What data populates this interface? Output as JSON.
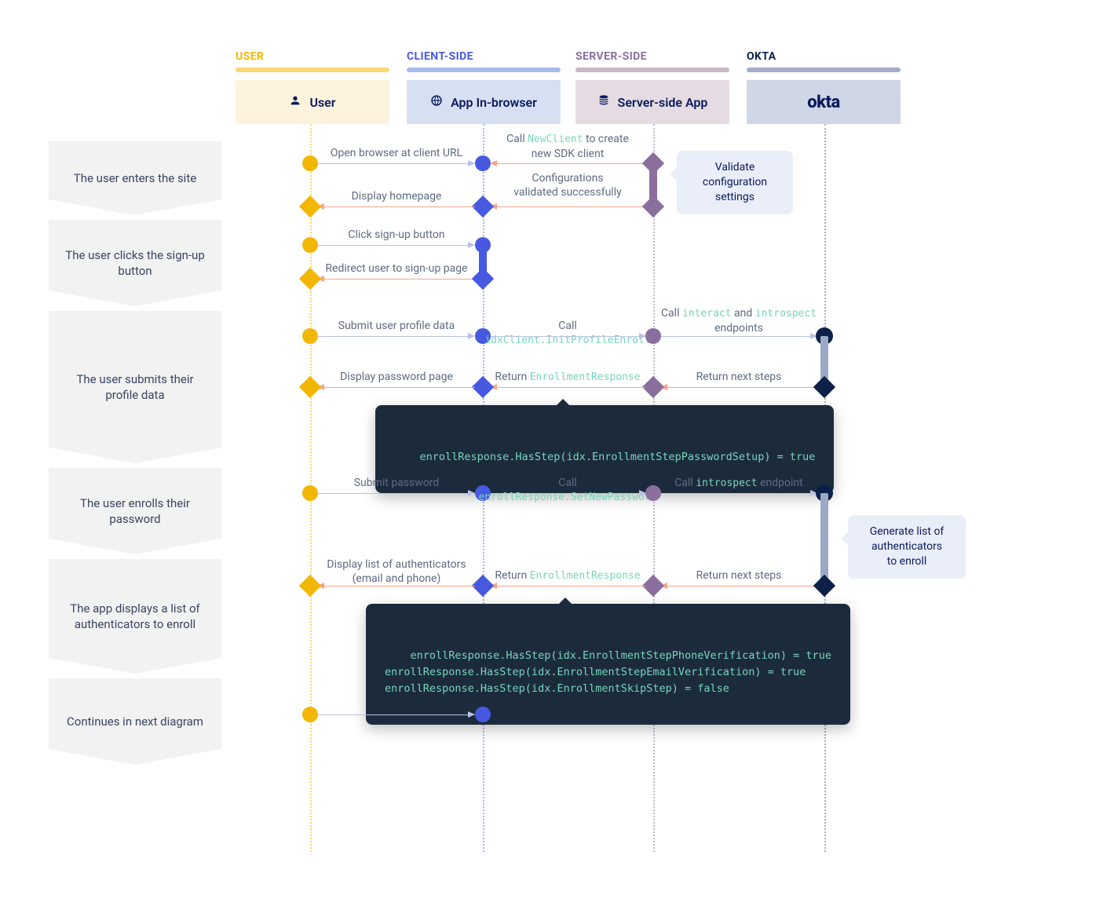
{
  "columns": {
    "user": {
      "label": "USER",
      "lane_label": "User",
      "color": "#f2b705",
      "bg": "#fdf3dd"
    },
    "client": {
      "label": "CLIENT-SIDE",
      "lane_label": "App In-browser",
      "color": "#4659e0",
      "bg": "#d6e0f2"
    },
    "server": {
      "label": "SERVER-SIDE",
      "lane_label": "Server-side App",
      "color": "#8a6f9e",
      "bg": "#e6dbe2"
    },
    "okta": {
      "label": "OKTA",
      "lane_label": "okta",
      "color": "#0c2048",
      "bg": "#cfd6e5"
    }
  },
  "step_arrows": [
    "The user enters the site",
    "The user clicks the sign-up button",
    "The user submits their profile data",
    "The user enrolls their password",
    "The app displays a list of authenticators to enroll",
    "Continues in next diagram"
  ],
  "callouts": {
    "validate": {
      "lines": [
        "Validate",
        "configuration",
        "settings"
      ]
    },
    "generate_auth": {
      "lines": [
        "Generate list of",
        "authenticators",
        "to enroll"
      ]
    }
  },
  "messages": {
    "open_browser": "Open browser at client URL",
    "new_client_pre": "Call ",
    "new_client_code": "NewClient",
    "new_client_post": " to create\nnew SDK client",
    "config_validated": "Configurations\nvalidated successfully",
    "display_homepage": "Display homepage",
    "click_signup": "Click sign-up button",
    "redirect_signup": "Redirect user to sign-up page",
    "submit_profile": "Submit user profile data",
    "init_profile_pre": "Call ",
    "init_profile_code": "idxClient.InitProfileEnroll",
    "interact_pre": "Call ",
    "interact_code1": "interact",
    "interact_mid": " and ",
    "interact_code2": "introspect",
    "interact_post": "\nendpoints",
    "return_next_steps": "Return next steps",
    "return_enroll_pre": "Return ",
    "return_enroll_code": "EnrollmentResponse",
    "display_password_page": "Display password page",
    "submit_password": "Submit password",
    "set_new_password_pre": "Call ",
    "set_new_password_code": "enrollResponse.SetNewPassword",
    "introspect_endpoint_pre": "Call ",
    "introspect_endpoint_code": "introspect",
    "introspect_endpoint_post": " endpoint",
    "display_list_auth": "Display list of authenticators\n(email and phone)"
  },
  "code_blocks": {
    "password_setup": "enrollResponse.HasStep(idx.EnrollmentStepPasswordSetup) = true",
    "auth_list": "enrollResponse.HasStep(idx.EnrollmentStepPhoneVerification) = true\nenrollResponse.HasStep(idx.EnrollmentStepEmailVerification) = true\nenrollResponse.HasStep(idx.EnrollmentSkipStep) = false"
  },
  "chart_data": {
    "type": "sequence_diagram",
    "participants": [
      {
        "id": "user",
        "label": "User",
        "category": "USER"
      },
      {
        "id": "client",
        "label": "App In-browser",
        "category": "CLIENT-SIDE"
      },
      {
        "id": "server",
        "label": "Server-side App",
        "category": "SERVER-SIDE"
      },
      {
        "id": "okta",
        "label": "okta",
        "category": "OKTA"
      }
    ],
    "side_steps": [
      "The user enters the site",
      "The user clicks the sign-up button",
      "The user submits their profile data",
      "The user enrolls their password",
      "The app displays a list of authenticators to enroll",
      "Continues in next diagram"
    ],
    "messages": [
      {
        "from": "user",
        "to": "client",
        "label": "Open browser at client URL",
        "kind": "forward"
      },
      {
        "from": "client",
        "to": "server",
        "label": "Call NewClient to create new SDK client",
        "kind": "forward"
      },
      {
        "from": "server",
        "to": "server",
        "label": "Validate configuration settings",
        "kind": "self_note"
      },
      {
        "from": "server",
        "to": "client",
        "label": "Configurations validated successfully",
        "kind": "return"
      },
      {
        "from": "client",
        "to": "user",
        "label": "Display homepage",
        "kind": "return"
      },
      {
        "from": "user",
        "to": "client",
        "label": "Click sign-up button",
        "kind": "forward"
      },
      {
        "from": "client",
        "to": "user",
        "label": "Redirect user to sign-up page",
        "kind": "return"
      },
      {
        "from": "user",
        "to": "client",
        "label": "Submit user profile data",
        "kind": "forward"
      },
      {
        "from": "client",
        "to": "server",
        "label": "Call idxClient.InitProfileEnroll",
        "kind": "forward"
      },
      {
        "from": "server",
        "to": "okta",
        "label": "Call interact and introspect endpoints",
        "kind": "forward"
      },
      {
        "from": "okta",
        "to": "server",
        "label": "Return next steps",
        "kind": "return"
      },
      {
        "from": "server",
        "to": "client",
        "label": "Return EnrollmentResponse",
        "kind": "return"
      },
      {
        "note": "enrollResponse.HasStep(idx.EnrollmentStepPasswordSetup) = true",
        "attached_to": "client"
      },
      {
        "from": "client",
        "to": "user",
        "label": "Display password page",
        "kind": "return"
      },
      {
        "from": "user",
        "to": "client",
        "label": "Submit password",
        "kind": "forward"
      },
      {
        "from": "client",
        "to": "server",
        "label": "Call enrollResponse.SetNewPassword",
        "kind": "forward"
      },
      {
        "from": "server",
        "to": "okta",
        "label": "Call introspect endpoint",
        "kind": "forward"
      },
      {
        "from": "okta",
        "to": "okta",
        "label": "Generate list of authenticators to enroll",
        "kind": "self_note"
      },
      {
        "from": "okta",
        "to": "server",
        "label": "Return next steps",
        "kind": "return"
      },
      {
        "from": "server",
        "to": "client",
        "label": "Return EnrollmentResponse",
        "kind": "return"
      },
      {
        "note": "enrollResponse.HasStep(idx.EnrollmentStepPhoneVerification) = true\nenrollResponse.HasStep(idx.EnrollmentStepEmailVerification) = true\nenrollResponse.HasStep(idx.EnrollmentSkipStep) = false",
        "attached_to": "client"
      },
      {
        "from": "client",
        "to": "user",
        "label": "Display list of authenticators (email and phone)",
        "kind": "return"
      },
      {
        "from": "user",
        "to": "client",
        "label": "",
        "kind": "forward"
      }
    ]
  }
}
